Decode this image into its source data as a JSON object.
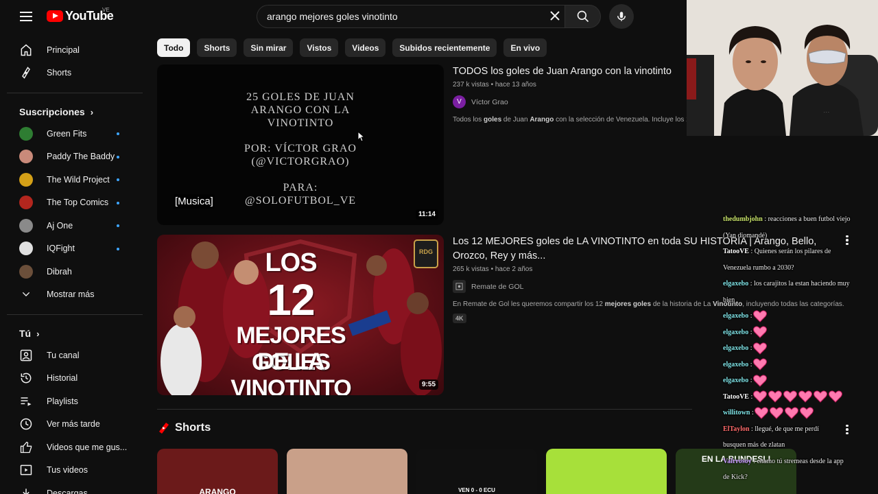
{
  "app": {
    "logo_text": "YouTube",
    "country_code": "VE"
  },
  "search": {
    "query": "arango mejores goles vinotinto"
  },
  "sidebar": {
    "main": [
      {
        "label": "Principal",
        "icon": "home-icon"
      },
      {
        "label": "Shorts",
        "icon": "shorts-icon"
      }
    ],
    "subscriptions_title": "Suscripciones",
    "subscriptions": [
      {
        "label": "Green Fits",
        "color": "#2e7d32",
        "new": true
      },
      {
        "label": "Paddy The Baddy",
        "color": "#c98a7a",
        "new": true
      },
      {
        "label": "The Wild Project",
        "color": "#d4a017",
        "new": true
      },
      {
        "label": "The Top Comics",
        "color": "#b3261e",
        "new": true
      },
      {
        "label": "Aj One",
        "color": "#8a8a8a",
        "new": true
      },
      {
        "label": "IQFight",
        "color": "#e0e0e0",
        "new": true
      },
      {
        "label": "Dibrah",
        "color": "#6b4f3a",
        "new": false
      }
    ],
    "show_more": "Mostrar más",
    "you_title": "Tú",
    "you": [
      {
        "label": "Tu canal",
        "icon": "channel-icon"
      },
      {
        "label": "Historial",
        "icon": "history-icon"
      },
      {
        "label": "Playlists",
        "icon": "playlists-icon"
      },
      {
        "label": "Ver más tarde",
        "icon": "watch-later-icon"
      },
      {
        "label": "Videos que me gus...",
        "icon": "like-icon"
      },
      {
        "label": "Tus videos",
        "icon": "your-videos-icon"
      },
      {
        "label": "Descargas",
        "icon": "download-icon"
      }
    ]
  },
  "chips": [
    "Todo",
    "Shorts",
    "Sin mirar",
    "Vistos",
    "Videos",
    "Subidos recientemente",
    "En vivo"
  ],
  "results": [
    {
      "title": "TODOS los goles de Juan Arango con la vinotinto",
      "views": "237 k vistas",
      "age": "hace 13 años",
      "channel": "Víctor Grao",
      "channel_initial": "V",
      "channel_color": "#7b1fa2",
      "desc_parts": [
        "Todos los ",
        "goles",
        " de Juan ",
        "Arango",
        " con la selección de Venezuela. Incluye los 2"
      ],
      "duration": "11:14",
      "thumb_lines": [
        "25 GOLES DE JUAN",
        "ARANGO CON LA",
        "VINOTINTO",
        "POR: VÍCTOR GRAO",
        "(@VICTORGRAO)",
        "PARA:",
        "@SOLOFUTBOL_VE"
      ],
      "caption": "[Musica]"
    },
    {
      "title_line1": "Los 12 MEJORES goles de LA VINOTINTO en toda SU HISTORIA | Arango, Bello,",
      "title_line2": "Orozco, Rey y más...",
      "views": "265 k vistas",
      "age": "hace 2 años",
      "channel": "Remate de GOL",
      "desc_parts": [
        "En Remate de Gol les queremos compartir los 12 ",
        "mejores goles",
        " de la historia de La ",
        "Vinotinto",
        ", incluyendo todas las categorías."
      ],
      "badge": "4K",
      "duration": "9:55",
      "thumb_lines": [
        "LOS",
        "12",
        "MEJORES GOLES",
        "DE LA VINOTINTO"
      ],
      "thumb_logo": "RDG"
    }
  ],
  "shorts": {
    "title": "Shorts",
    "items": [
      {
        "color": "#6b1a1a",
        "text": "ARANGO"
      },
      {
        "color": "#c9a089",
        "text": ""
      },
      {
        "color": "#101010",
        "text": "VEN 0 - 0 ECU"
      },
      {
        "color": "#a7e03a",
        "text": ""
      },
      {
        "color": "#243a18",
        "text": "EN LA BUNDESLI"
      }
    ]
  },
  "chat": [
    {
      "user": "thedumbjohn",
      "user_color": "#c8e36a",
      "msg": ": reacciones a buen futbol viejo"
    },
    {
      "user": "",
      "user_color": "#ececec",
      "msg": "(Yan diomandé)"
    },
    {
      "user": "TatooVE",
      "user_color": "#ffffff",
      "msg": ": Quienes serán los pilares de"
    },
    {
      "user": "",
      "user_color": "#ececec",
      "msg": "Venezuela rumbo a 2030?"
    },
    {
      "user": "elgaxebo",
      "user_color": "#7fe3e6",
      "msg": ": los carajitos la estan haciendo muy"
    },
    {
      "user": "",
      "user_color": "#ececec",
      "msg": "bien"
    },
    {
      "user": "elgaxebo",
      "user_color": "#7fe3e6",
      "msg": ":",
      "hearts": 1
    },
    {
      "user": "elgaxebo",
      "user_color": "#7fe3e6",
      "msg": ":",
      "hearts": 1
    },
    {
      "user": "elgaxebo",
      "user_color": "#7fe3e6",
      "msg": ":",
      "hearts": 1
    },
    {
      "user": "elgaxebo",
      "user_color": "#7fe3e6",
      "msg": ":",
      "hearts": 1
    },
    {
      "user": "elgaxebo",
      "user_color": "#7fe3e6",
      "msg": ":",
      "hearts": 1
    },
    {
      "user": "TatooVE",
      "user_color": "#ffffff",
      "msg": ":",
      "hearts": 6
    },
    {
      "user": "willitown",
      "user_color": "#7fe3e6",
      "msg": ":",
      "hearts": 4
    },
    {
      "user": "ElTaylon",
      "user_color": "#ff6b6b",
      "msg": ": llegué, de que me perdí"
    },
    {
      "user": "",
      "user_color": "#ececec",
      "msg": "busquen más de zlatan"
    },
    {
      "user": "Valrrosoy",
      "user_color": "#c9a0ff",
      "msg": ": chamo tú stremeas desde la app"
    },
    {
      "user": "",
      "user_color": "#ececec",
      "msg": "de Kick?"
    }
  ],
  "colors": {
    "bg": "#0f0f0f",
    "accent": "#ff0000",
    "link_blue": "#3ea6ff"
  }
}
